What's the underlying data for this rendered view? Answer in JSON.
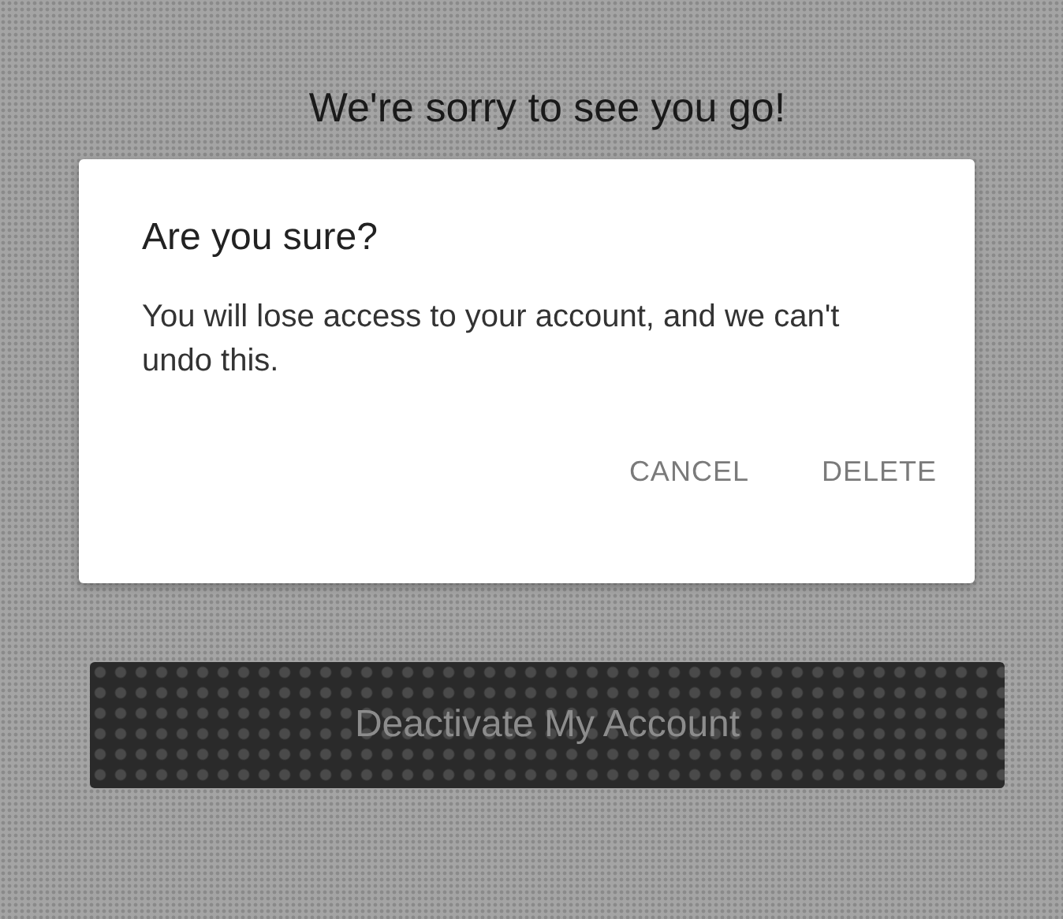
{
  "heading": "We're sorry to see you go!",
  "dialog": {
    "title": "Are you sure?",
    "message": "You will lose access to your account, and we can't undo this.",
    "actions": [
      "CANCEL",
      "DELETE"
    ]
  },
  "deactivate_button": {
    "label": "Deactivate My Account",
    "disabled": true
  }
}
